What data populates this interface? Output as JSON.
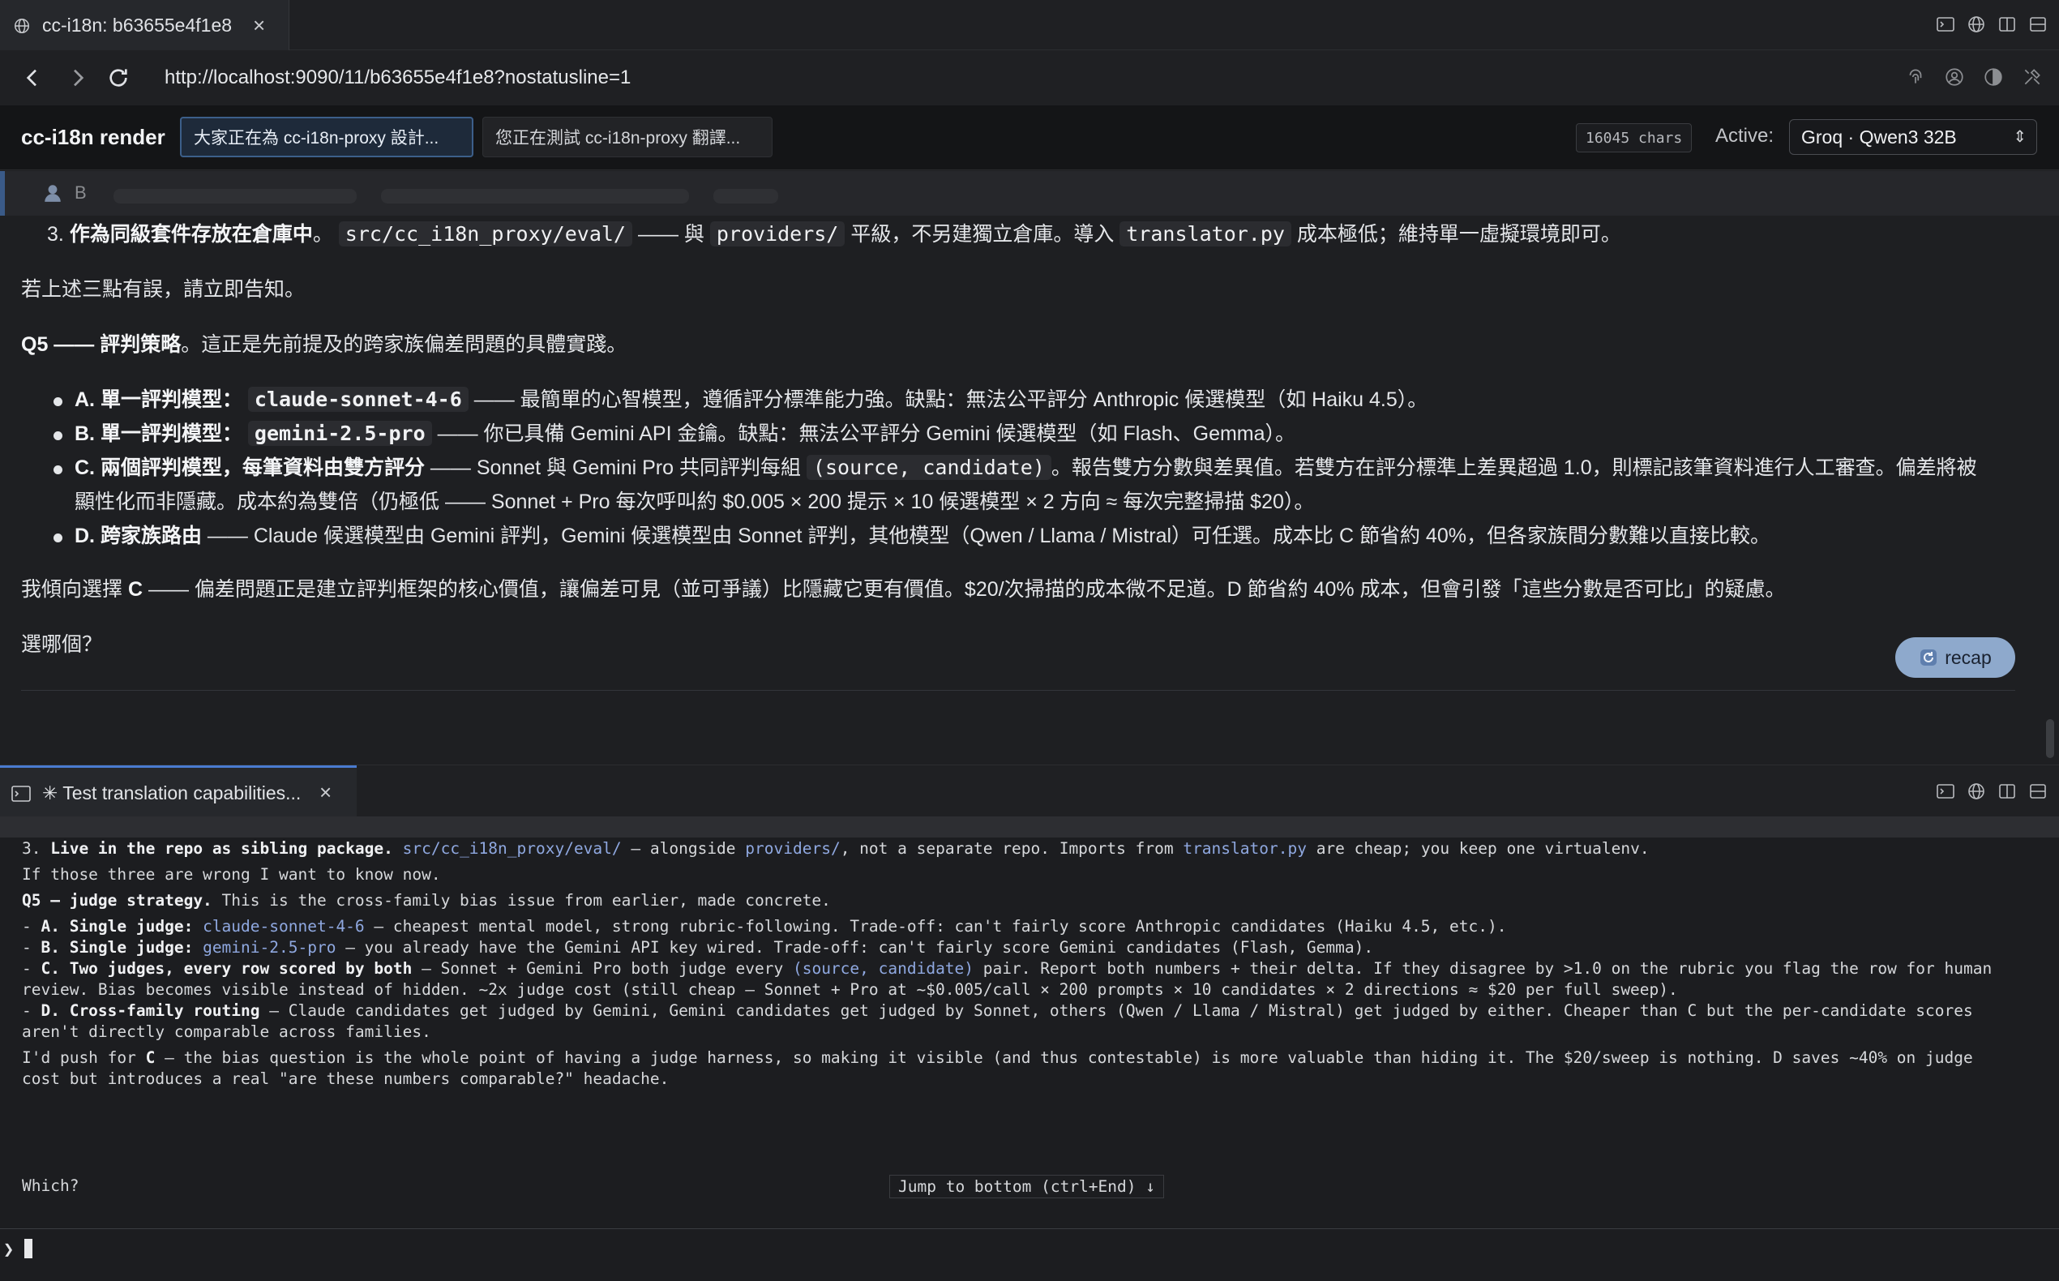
{
  "browser": {
    "tab_title": "cc-i18n: b63655e4f1e8",
    "tab_close": "×",
    "url": "http://localhost:9090/11/b63655e4f1e8?nostatusline=1"
  },
  "app": {
    "name": "cc-i18n render",
    "prompt_tabs": [
      {
        "label": "大家正在為 cc-i18n-proxy 設計..."
      },
      {
        "label": "您正在測試 cc-i18n-proxy 翻譯..."
      }
    ],
    "char_count": "16045 chars",
    "active_label": "Active:",
    "active_model": "Groq · Qwen3 32B",
    "select_caret": "⇕"
  },
  "main": {
    "user_initial": "B",
    "line_3": {
      "num": "3.",
      "bold": "作為同級套件存放在倉庫中",
      "t1": "。",
      "code1": "src/cc_i18n_proxy/eval/",
      "t2": "—— 與",
      "code2": "providers/",
      "t3": "平級，不另建獨立倉庫。導入",
      "code3": "translator.py",
      "t4": "成本極低；維持單一虛擬環境即可。"
    },
    "wrong_line": "若上述三點有誤，請立即告知。",
    "q5": {
      "bold": "Q5 —— 評判策略",
      "rest": "。這正是先前提及的跨家族偏差問題的具體實踐。"
    },
    "options": {
      "a": {
        "bold": "A. 單一評判模型：",
        "code": "claude-sonnet-4-6",
        "rest": "—— 最簡單的心智模型，遵循評分標準能力強。缺點：無法公平評分 Anthropic 候選模型（如 Haiku 4.5）。"
      },
      "b": {
        "bold": "B. 單一評判模型：",
        "code": "gemini-2.5-pro",
        "rest": "—— 你已具備 Gemini API 金鑰。缺點：無法公平評分 Gemini 候選模型（如 Flash、Gemma）。"
      },
      "c": {
        "bold": "C. 兩個評判模型，每筆資料由雙方評分",
        "t1": "—— Sonnet 與 Gemini Pro 共同評判每組",
        "code": "(source, candidate)",
        "t2": "。報告雙方分數與差異值。若雙方在評分標準上差異超過 1.0，則標記該筆資料進行人工審查。偏差將被",
        "line2": "顯性化而非隱藏。成本約為雙倍（仍極低 —— Sonnet + Pro 每次呼叫約 $0.005 × 200 提示 × 10 候選模型 × 2 方向 ≈ 每次完整掃描 $20）。"
      },
      "d": {
        "bold": "D. 跨家族路由",
        "rest": "—— Claude 候選模型由 Gemini 評判，Gemini 候選模型由 Sonnet 評判，其他模型（Qwen / Llama / Mistral）可任選。成本比 C 節省約 40%，但各家族間分數難以直接比較。"
      }
    },
    "prefer": {
      "t1": "我傾向選擇",
      "bold": "C",
      "t2": "—— 偏差問題正是建立評判框架的核心價值，讓偏差可見（並可爭議）比隱藏它更有價值。$20/次掃描的成本微不足道。D 節省約 40% 成本，但會引發「這些分數是否可比」的疑慮。"
    },
    "which": "選哪個？",
    "recap_label": "recap"
  },
  "terminal": {
    "tab_title": "✳ Test translation capabilities...",
    "tab_close": "×",
    "l1": {
      "a": "3. ",
      "b": "Live in the repo as sibling package.",
      "c": " ",
      "r1": "src/cc_i18n_proxy/eval/",
      "d": " — alongside ",
      "r2": "providers/",
      "e": ", not a separate repo. Imports from ",
      "r3": "translator.py",
      "f": " are cheap; you keep one virtualenv."
    },
    "l2": "If those three are wrong I want to know now.",
    "l3": {
      "b": "Q5 — judge strategy.",
      "c": " This is the cross-family bias issue from earlier, made concrete."
    },
    "la": {
      "p": "- ",
      "b": "A. Single judge:",
      "s": " ",
      "r": "claude-sonnet-4-6",
      "c": " — cheapest mental model, strong rubric-following. Trade-off: can't fairly score Anthropic candidates (Haiku 4.5, etc.)."
    },
    "lb": {
      "p": "- ",
      "b": "B. Single judge:",
      "s": " ",
      "r": "gemini-2.5-pro",
      "c": " — you already have the Gemini API key wired. Trade-off: can't fairly score Gemini candidates (Flash, Gemma)."
    },
    "lc": {
      "p": "- ",
      "b": "C. Two judges, every row scored by both",
      "c": " — Sonnet + Gemini Pro both judge every ",
      "r": "(source, candidate)",
      "d": " pair. Report both numbers + their delta. If they disagree by >1.0 on the rubric you flag the row for human"
    },
    "lc2": "review. Bias becomes visible instead of hidden. ~2x judge cost (still cheap — Sonnet + Pro at ~$0.005/call × 200 prompts × 10 candidates × 2 directions ≈ $20 per full sweep).",
    "ld": {
      "p": "- ",
      "b": "D. Cross-family routing",
      "c": " — Claude candidates get judged by Gemini, Gemini candidates get judged by Sonnet, others (Qwen / Llama / Mistral) get judged by either. Cheaper than C but the per-candidate scores"
    },
    "ld2": "aren't directly comparable across families.",
    "lp": {
      "a": "I'd push for ",
      "b": "C",
      "c": " — the bias question is the whole point of having a judge harness, so making it visible (and thus contestable) is more valuable than hiding it. The $20/sweep is nothing. D saves ~40% on judge"
    },
    "lp2": "cost but introduces a real \"are these numbers comparable?\" headache.",
    "which": "Which?",
    "jump": "Jump to bottom (ctrl+End) ↓",
    "prompt": "❯"
  },
  "colors": {
    "accent": "#4a7bd0",
    "ref": "#8fa8e0",
    "recap": "#8ea9cc"
  }
}
